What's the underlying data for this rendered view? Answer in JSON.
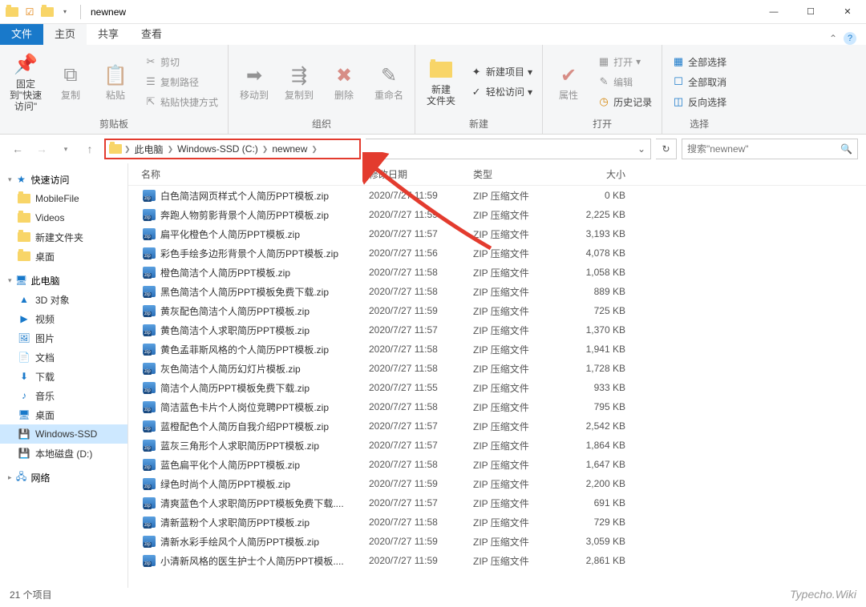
{
  "window": {
    "title": "newnew"
  },
  "tabs": {
    "file": "文件",
    "home": "主页",
    "share": "共享",
    "view": "查看"
  },
  "ribbon": {
    "clipboard": {
      "label": "剪贴板",
      "pin": "固定到\"快速访问\"",
      "copy": "复制",
      "paste": "粘贴",
      "cut": "剪切",
      "copypath": "复制路径",
      "pasteshortcut": "粘贴快捷方式"
    },
    "organize": {
      "label": "组织",
      "moveto": "移动到",
      "copyto": "复制到",
      "delete": "删除",
      "rename": "重命名"
    },
    "new": {
      "label": "新建",
      "newfolder": "新建\n文件夹",
      "newitem": "新建项目",
      "easyaccess": "轻松访问"
    },
    "open": {
      "label": "打开",
      "properties": "属性",
      "open": "打开",
      "edit": "编辑",
      "history": "历史记录"
    },
    "select": {
      "label": "选择",
      "all": "全部选择",
      "none": "全部取消",
      "invert": "反向选择"
    }
  },
  "breadcrumb": {
    "pc": "此电脑",
    "drive": "Windows-SSD (C:)",
    "folder": "newnew"
  },
  "search": {
    "placeholder": "搜索\"newnew\""
  },
  "sidebar": {
    "quick": "快速访问",
    "quick_items": [
      "MobileFile",
      "Videos",
      "新建文件夹",
      "桌面"
    ],
    "thispc": "此电脑",
    "pc_items": [
      "3D 对象",
      "视频",
      "图片",
      "文档",
      "下载",
      "音乐",
      "桌面",
      "Windows-SSD",
      "本地磁盘 (D:)"
    ],
    "network": "网络"
  },
  "columns": {
    "name": "名称",
    "date": "修改日期",
    "type": "类型",
    "size": "大小"
  },
  "filetype": "ZIP 压缩文件",
  "files": [
    {
      "name": "白色简洁网页样式个人简历PPT模板.zip",
      "date": "2020/7/27 11:59",
      "size": "0 KB"
    },
    {
      "name": "奔跑人物剪影背景个人简历PPT模板.zip",
      "date": "2020/7/27 11:59",
      "size": "2,225 KB"
    },
    {
      "name": "扁平化橙色个人简历PPT模板.zip",
      "date": "2020/7/27 11:57",
      "size": "3,193 KB"
    },
    {
      "name": "彩色手绘多边形背景个人简历PPT模板.zip",
      "date": "2020/7/27 11:56",
      "size": "4,078 KB"
    },
    {
      "name": "橙色简洁个人简历PPT模板.zip",
      "date": "2020/7/27 11:58",
      "size": "1,058 KB"
    },
    {
      "name": "黑色简洁个人简历PPT模板免费下载.zip",
      "date": "2020/7/27 11:58",
      "size": "889 KB"
    },
    {
      "name": "黄灰配色简洁个人简历PPT模板.zip",
      "date": "2020/7/27 11:59",
      "size": "725 KB"
    },
    {
      "name": "黄色简洁个人求职简历PPT模板.zip",
      "date": "2020/7/27 11:57",
      "size": "1,370 KB"
    },
    {
      "name": "黄色孟菲斯风格的个人简历PPT模板.zip",
      "date": "2020/7/27 11:58",
      "size": "1,941 KB"
    },
    {
      "name": "灰色简洁个人简历幻灯片模板.zip",
      "date": "2020/7/27 11:58",
      "size": "1,728 KB"
    },
    {
      "name": "简洁个人简历PPT模板免费下载.zip",
      "date": "2020/7/27 11:55",
      "size": "933 KB"
    },
    {
      "name": "简洁蓝色卡片个人岗位竞聘PPT模板.zip",
      "date": "2020/7/27 11:58",
      "size": "795 KB"
    },
    {
      "name": "蓝橙配色个人简历自我介绍PPT模板.zip",
      "date": "2020/7/27 11:57",
      "size": "2,542 KB"
    },
    {
      "name": "蓝灰三角形个人求职简历PPT模板.zip",
      "date": "2020/7/27 11:57",
      "size": "1,864 KB"
    },
    {
      "name": "蓝色扁平化个人简历PPT模板.zip",
      "date": "2020/7/27 11:58",
      "size": "1,647 KB"
    },
    {
      "name": "绿色时尚个人简历PPT模板.zip",
      "date": "2020/7/27 11:59",
      "size": "2,200 KB"
    },
    {
      "name": "清爽蓝色个人求职简历PPT模板免费下载....",
      "date": "2020/7/27 11:57",
      "size": "691 KB"
    },
    {
      "name": "清新蓝粉个人求职简历PPT模板.zip",
      "date": "2020/7/27 11:58",
      "size": "729 KB"
    },
    {
      "name": "清新水彩手绘风个人简历PPT模板.zip",
      "date": "2020/7/27 11:59",
      "size": "3,059 KB"
    },
    {
      "name": "小清新风格的医生护士个人简历PPT模板....",
      "date": "2020/7/27 11:59",
      "size": "2,861 KB"
    }
  ],
  "status": "21 个项目",
  "watermark": "Typecho.Wiki"
}
